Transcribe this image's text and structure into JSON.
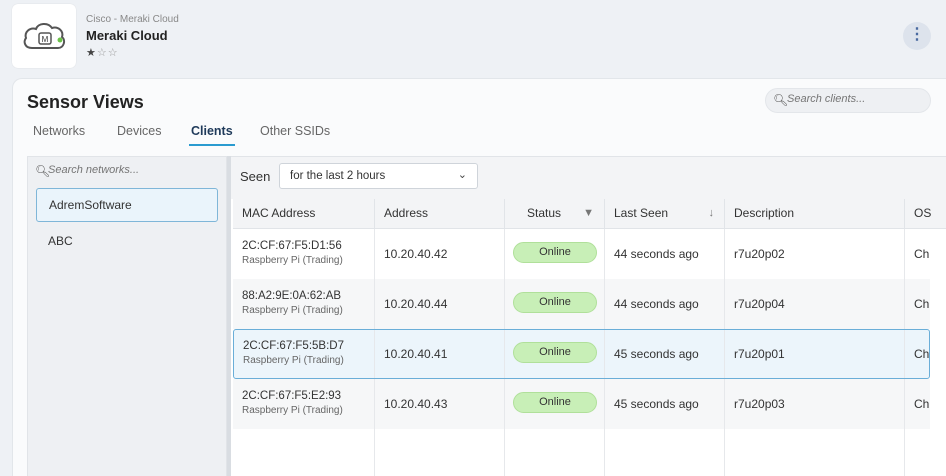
{
  "app": {
    "vendor": "Cisco - Meraki Cloud",
    "title": "Meraki Cloud",
    "rating": {
      "filled": 1,
      "total": 3
    },
    "icon": "cloud-m-icon",
    "more_icon": "vertical-ellipsis-icon"
  },
  "page": {
    "title": "Sensor Views",
    "search_placeholder": "Search clients..."
  },
  "tabs": [
    {
      "label": "Networks",
      "active": false
    },
    {
      "label": "Devices",
      "active": false
    },
    {
      "label": "Clients",
      "active": true
    },
    {
      "label": "Other SSIDs",
      "active": false
    }
  ],
  "networks": {
    "search_placeholder": "Search networks...",
    "items": [
      {
        "label": "AdremSoftware",
        "selected": true
      },
      {
        "label": "ABC",
        "selected": false
      }
    ]
  },
  "filter": {
    "seen_label": "Seen",
    "seen_value": "for the last 2 hours"
  },
  "table": {
    "columns": [
      "MAC Address",
      "Address",
      "Status",
      "Last Seen",
      "Description",
      "OS"
    ],
    "rows": [
      {
        "mac": "2C:CF:67:F5:D1:56",
        "device": "Raspberry Pi (Trading)",
        "address": "10.20.40.42",
        "status": "Online",
        "last_seen": "44 seconds ago",
        "description": "r7u20p02",
        "os": "Chr"
      },
      {
        "mac": "88:A2:9E:0A:62:AB",
        "device": "Raspberry Pi (Trading)",
        "address": "10.20.40.44",
        "status": "Online",
        "last_seen": "44 seconds ago",
        "description": "r7u20p04",
        "os": "Chr"
      },
      {
        "mac": "2C:CF:67:F5:5B:D7",
        "device": "Raspberry Pi (Trading)",
        "address": "10.20.40.41",
        "status": "Online",
        "last_seen": "45 seconds ago",
        "description": "r7u20p01",
        "os": "Chr"
      },
      {
        "mac": "2C:CF:67:F5:E2:93",
        "device": "Raspberry Pi (Trading)",
        "address": "10.20.40.43",
        "status": "Online",
        "last_seen": "45 seconds ago",
        "description": "r7u20p03",
        "os": "Chr"
      }
    ]
  },
  "colors": {
    "accent": "#2a9bd0",
    "online_badge": "#c8efb7",
    "selection_border": "#6aaed8"
  }
}
